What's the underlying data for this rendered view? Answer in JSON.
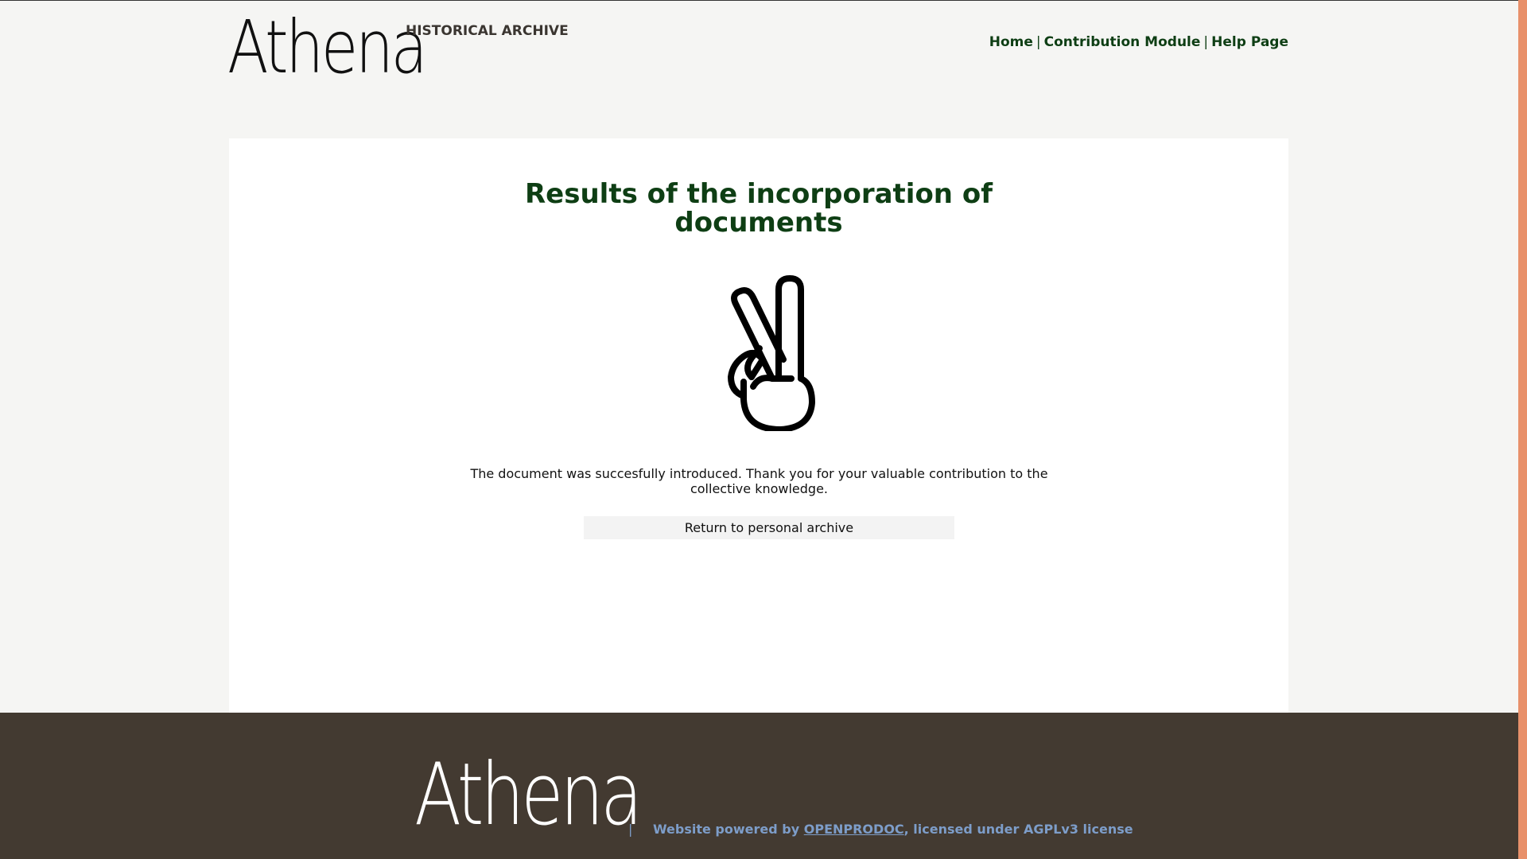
{
  "header": {
    "logo_text": "Athena",
    "subtitle": "HISTORICAL ARCHIVE",
    "nav": [
      {
        "label": "Home"
      },
      {
        "label": "Contribution Module"
      },
      {
        "label": "Help Page"
      }
    ],
    "nav_separator": "|"
  },
  "main": {
    "title_line1": "Results of the incorporation of",
    "title_line2": "documents",
    "icon": "peace-hand-icon",
    "message": "The document was succesfully introduced. Thank you for your valuable contribution to the collective knowledge.",
    "return_button_label": "Return to personal archive"
  },
  "footer": {
    "logo_text": "Athena",
    "separator": "|",
    "powered_prefix": "Website powered by",
    "powered_link": "OPENPRODOC",
    "license_text": ", licensed under AGPLv3 license"
  },
  "colors": {
    "background": "#f5f5f3",
    "accent_green": "#0e3e14",
    "footer_bg": "#433a31",
    "footer_link": "#7d9dc9",
    "right_edge": "#e8906a"
  }
}
